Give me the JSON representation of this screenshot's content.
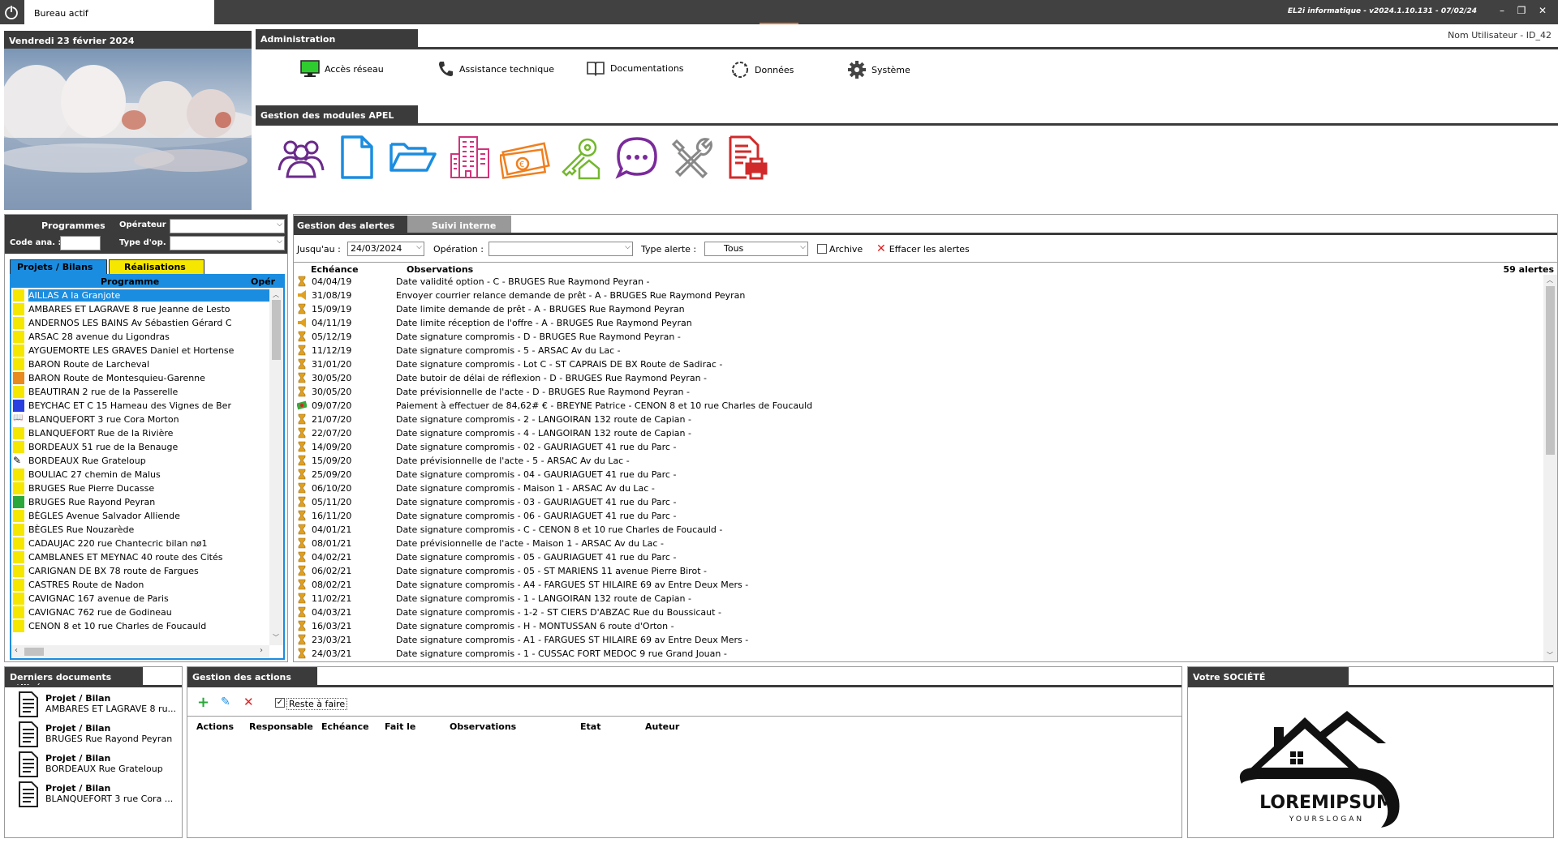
{
  "titlebar": {
    "tab_label": "Bureau actif",
    "version": "EL2i informatique - v2024.1.10.131 - 07/02/24",
    "minimize": "–",
    "restore": "❐",
    "close": "✕"
  },
  "date_panel": {
    "date": "Vendredi 23 février 2024"
  },
  "admin": {
    "title": "Administration",
    "username": "Nom Utilisateur - ID_42",
    "items": [
      {
        "label": "Accès réseau",
        "icon": "monitor-icon"
      },
      {
        "label": "Assistance technique",
        "icon": "phone-icon"
      },
      {
        "label": "Documentations",
        "icon": "book-icon"
      },
      {
        "label": "Données",
        "icon": "sync-icon"
      },
      {
        "label": "Système",
        "icon": "gear-icon"
      }
    ]
  },
  "apel": {
    "title": "Gestion des modules APEL",
    "icons": [
      "users-icon",
      "document-icon",
      "folder-icon",
      "building-icon",
      "money-icon",
      "key-house-icon",
      "chat-icon",
      "tools-icon",
      "pdf-print-icon"
    ],
    "colors": {
      "users": "#6a2a8a",
      "document": "#1b8de0",
      "folder": "#1b8de0",
      "building": "#d1337c",
      "money": "#f07f1e",
      "key": "#74b72e",
      "chat": "#7a2a9a",
      "tools": "#888888",
      "pdf": "#d12a2a"
    }
  },
  "programmes": {
    "title": "Programmes",
    "operateur_label": "Opérateur :",
    "code_ana_label": "Code ana. :",
    "type_op_label": "Type d'op. :",
    "tab_projets": "Projets / Bilans",
    "tab_realisations": "Réalisations",
    "col_programme": "Programme",
    "col_operateur": "Opér",
    "rows": [
      {
        "label": "AILLAS A la Granjote",
        "color": "#f5e700",
        "selected": true
      },
      {
        "label": "AMBARES ET LAGRAVE 8 rue Jeanne de Lesto",
        "color": "#f5e700"
      },
      {
        "label": "ANDERNOS LES BAINS Av Sébastien Gérard C",
        "color": "#f5e700"
      },
      {
        "label": "ARSAC 28 avenue du Ligondras",
        "color": "#f5e700"
      },
      {
        "label": "AYGUEMORTE LES GRAVES Daniel et Hortense",
        "color": "#f5e700"
      },
      {
        "label": "BARON Route de Larcheval",
        "color": "#f5e700"
      },
      {
        "label": "BARON Route de Montesquieu-Garenne",
        "color": "#e88a1e"
      },
      {
        "label": "BEAUTIRAN 2 rue de la Passerelle",
        "color": "#f5e700"
      },
      {
        "label": "BEYCHAC ET C 15 Hameau des Vignes de Ber",
        "color": "#2a3fe0"
      },
      {
        "label": "BLANQUEFORT 3 rue Cora Morton",
        "color": "book"
      },
      {
        "label": "BLANQUEFORT Rue de la Rivière",
        "color": "#f5e700"
      },
      {
        "label": "BORDEAUX 51 rue de la Benauge",
        "color": "#f5e700"
      },
      {
        "label": "BORDEAUX Rue Grateloup",
        "color": "pen"
      },
      {
        "label": "BOULIAC 27 chemin de Malus",
        "color": "#f5e700"
      },
      {
        "label": "BRUGES Rue Pierre Ducasse",
        "color": "#f5e700"
      },
      {
        "label": "BRUGES Rue Rayond Peyran",
        "color": "#2aa83a"
      },
      {
        "label": "BÈGLES Avenue Salvador Alliende",
        "color": "#f5e700"
      },
      {
        "label": "BÈGLES Rue Nouzarède",
        "color": "#f5e700"
      },
      {
        "label": "CADAUJAC 220 rue Chantecric bilan nø1",
        "color": "#f5e700"
      },
      {
        "label": "CAMBLANES ET MEYNAC 40 route des Cités",
        "color": "#f5e700"
      },
      {
        "label": "CARIGNAN DE BX 78 route de Fargues",
        "color": "#f5e700"
      },
      {
        "label": "CASTRES Route de Nadon",
        "color": "#f5e700"
      },
      {
        "label": "CAVIGNAC 167 avenue de Paris",
        "color": "#f5e700"
      },
      {
        "label": "CAVIGNAC 762 rue de Godineau",
        "color": "#f5e700"
      },
      {
        "label": "CENON 8 et 10 rue Charles de Foucauld",
        "color": "#f5e700"
      }
    ]
  },
  "alerts": {
    "tab_active": "Gestion des alertes",
    "tab_inactive": "Suivi interne",
    "jusquau_label": "Jusqu'au :",
    "jusquau_value": "24/03/2024",
    "operation_label": "Opération :",
    "type_alerte_label": "Type alerte :",
    "type_alerte_value": "Tous",
    "archive_label": "Archive",
    "clear_label": "Effacer les alertes",
    "col_echeance": "Echéance",
    "col_observations": "Observations",
    "count": "59 alertes",
    "rows": [
      {
        "date": "04/04/19",
        "obs": "Date validité option - C - BRUGES Rue Raymond Peyran -",
        "icon": "hourglass"
      },
      {
        "date": "31/08/19",
        "obs": "Envoyer courrier relance demande de prêt - A - BRUGES Rue Raymond Peyran",
        "icon": "megaphone"
      },
      {
        "date": "15/09/19",
        "obs": "Date limite demande de prêt - A - BRUGES Rue Raymond Peyran",
        "icon": "hourglass"
      },
      {
        "date": "04/11/19",
        "obs": "Date limite réception de l'offre - A - BRUGES Rue Raymond Peyran",
        "icon": "megaphone"
      },
      {
        "date": "05/12/19",
        "obs": "Date signature compromis - D - BRUGES Rue Raymond Peyran -",
        "icon": "hourglass"
      },
      {
        "date": "11/12/19",
        "obs": "Date signature compromis - 5 - ARSAC Av du Lac -",
        "icon": "hourglass"
      },
      {
        "date": "31/01/20",
        "obs": "Date signature compromis - Lot C - ST CAPRAIS DE BX Route de Sadirac -",
        "icon": "hourglass"
      },
      {
        "date": "30/05/20",
        "obs": "Date butoir de délai de réflexion - D - BRUGES Rue Raymond Peyran -",
        "icon": "hourglass"
      },
      {
        "date": "30/05/20",
        "obs": "Date prévisionnelle de l'acte - D - BRUGES Rue Raymond Peyran -",
        "icon": "hourglass"
      },
      {
        "date": "09/07/20",
        "obs": "Paiement à effectuer de 84,62# € - BREYNE Patrice - CENON 8 et 10 rue Charles de Foucauld",
        "icon": "money"
      },
      {
        "date": "21/07/20",
        "obs": "Date signature compromis - 2 - LANGOIRAN 132 route de Capian -",
        "icon": "hourglass"
      },
      {
        "date": "22/07/20",
        "obs": "Date signature compromis - 4 - LANGOIRAN 132 route de Capian -",
        "icon": "hourglass"
      },
      {
        "date": "14/09/20",
        "obs": "Date signature compromis - 02 - GAURIAGUET 41 rue du Parc -",
        "icon": "hourglass"
      },
      {
        "date": "15/09/20",
        "obs": "Date prévisionnelle de l'acte - 5 - ARSAC Av du Lac -",
        "icon": "hourglass"
      },
      {
        "date": "25/09/20",
        "obs": "Date signature compromis - 04 - GAURIAGUET 41 rue du Parc -",
        "icon": "hourglass"
      },
      {
        "date": "06/10/20",
        "obs": "Date signature compromis - Maison 1 - ARSAC Av du Lac -",
        "icon": "hourglass"
      },
      {
        "date": "05/11/20",
        "obs": "Date signature compromis - 03 - GAURIAGUET 41 rue du Parc -",
        "icon": "hourglass"
      },
      {
        "date": "16/11/20",
        "obs": "Date signature compromis - 06 - GAURIAGUET 41 rue du Parc -",
        "icon": "hourglass"
      },
      {
        "date": "04/01/21",
        "obs": "Date signature compromis - C - CENON 8 et 10 rue Charles de Foucauld -",
        "icon": "hourglass"
      },
      {
        "date": "08/01/21",
        "obs": "Date prévisionnelle de l'acte - Maison 1 - ARSAC Av du Lac -",
        "icon": "hourglass"
      },
      {
        "date": "04/02/21",
        "obs": "Date signature compromis - 05 - GAURIAGUET 41 rue du Parc -",
        "icon": "hourglass"
      },
      {
        "date": "06/02/21",
        "obs": "Date signature compromis - 05 - ST MARIENS 11 avenue Pierre Birot -",
        "icon": "hourglass"
      },
      {
        "date": "08/02/21",
        "obs": "Date signature compromis - A4 - FARGUES ST HILAIRE 69 av Entre Deux Mers -",
        "icon": "hourglass"
      },
      {
        "date": "11/02/21",
        "obs": "Date signature compromis - 1 - LANGOIRAN 132 route de Capian -",
        "icon": "hourglass"
      },
      {
        "date": "04/03/21",
        "obs": "Date signature compromis - 1-2 - ST CIERS D'ABZAC Rue du Boussicaut -",
        "icon": "hourglass"
      },
      {
        "date": "16/03/21",
        "obs": "Date signature compromis - H - MONTUSSAN 6 route d'Orton -",
        "icon": "hourglass"
      },
      {
        "date": "23/03/21",
        "obs": "Date signature compromis - A1 - FARGUES ST HILAIRE 69 av Entre Deux Mers -",
        "icon": "hourglass"
      },
      {
        "date": "24/03/21",
        "obs": "Date signature compromis - 1 - CUSSAC FORT MEDOC 9 rue Grand Jouan -",
        "icon": "hourglass"
      }
    ]
  },
  "docs": {
    "title": "Derniers documents utilisés",
    "items": [
      {
        "title": "Projet / Bilan",
        "sub": "AMBARES ET LAGRAVE 8 ru..."
      },
      {
        "title": "Projet / Bilan",
        "sub": "BRUGES Rue Rayond Peyran"
      },
      {
        "title": "Projet / Bilan",
        "sub": "BORDEAUX Rue Grateloup"
      },
      {
        "title": "Projet / Bilan",
        "sub": "BLANQUEFORT 3 rue Cora ..."
      }
    ]
  },
  "actions": {
    "title": "Gestion des actions",
    "reste_label": "Reste à faire",
    "columns": [
      "Actions",
      "Responsable",
      "Echéance",
      "Fait le",
      "Observations",
      "Etat",
      "Auteur"
    ]
  },
  "societe": {
    "title": "Votre SOCIÉTÉ",
    "logo_text": "LOREMIPSUM",
    "logo_slogan": "YOURSLOGAN"
  }
}
